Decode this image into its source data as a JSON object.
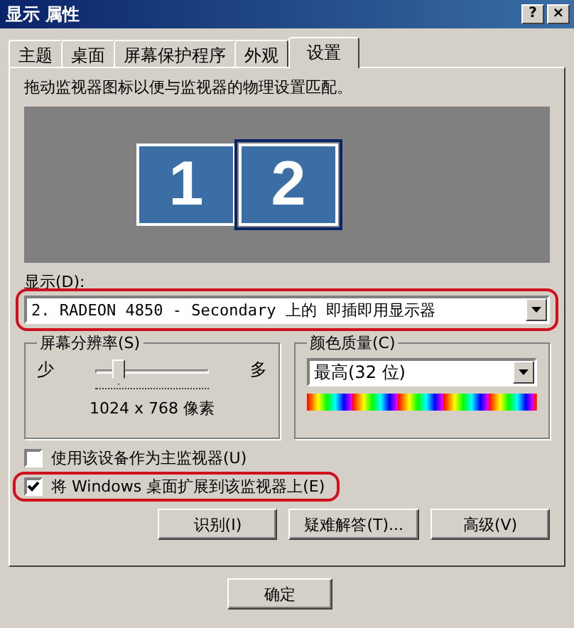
{
  "window": {
    "title": "显示 属性",
    "buttons": [
      "?",
      "×"
    ]
  },
  "tabs": [
    {
      "label": "主题",
      "selected": false
    },
    {
      "label": "桌面",
      "selected": false
    },
    {
      "label": "屏幕保护程序",
      "selected": false
    },
    {
      "label": "外观",
      "selected": false
    },
    {
      "label": "设置",
      "selected": true
    }
  ],
  "description": "拖动监视器图标以便与监视器的物理设置匹配。",
  "monitors": [
    {
      "label": "1",
      "selected": false
    },
    {
      "label": "2",
      "selected": true
    }
  ],
  "display": {
    "label": "显示(D):",
    "value": "2. RADEON 4850 - Secondary 上的 即插即用显示器",
    "highlighted": true
  },
  "resolution": {
    "title": "屏幕分辨率(S)",
    "min_label": "少",
    "max_label": "多",
    "level": 0.2,
    "reading": "1024 x 768 像素"
  },
  "color_quality": {
    "title": "颜色质量(C)",
    "value": "最高(32 位)"
  },
  "options": [
    {
      "label": "使用该设备作为主监视器(U)",
      "checked": false,
      "highlighted": false
    },
    {
      "label": "将 Windows 桌面扩展到该监视器上(E)",
      "checked": true,
      "highlighted": true
    }
  ],
  "buttons": [
    "识别(I)",
    "疑难解答(T)...",
    "高级(V)"
  ],
  "dialog_buttons": [
    "确定"
  ]
}
